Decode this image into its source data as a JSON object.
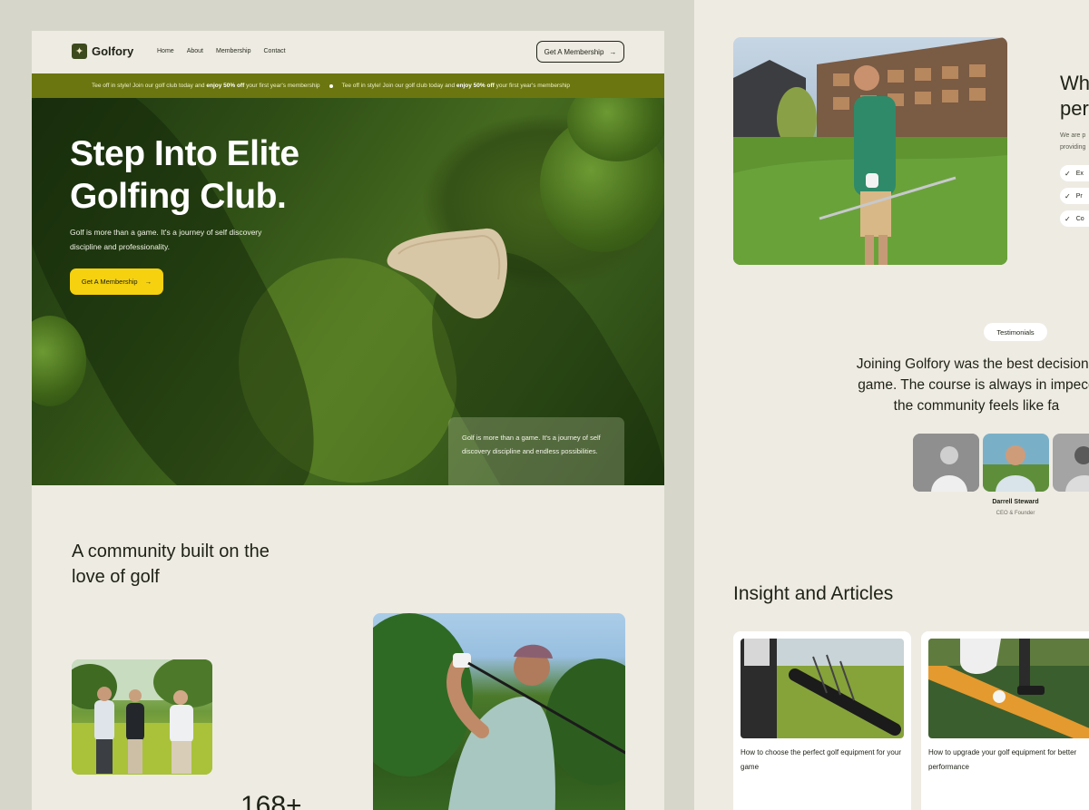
{
  "brand": {
    "name": "Golfory"
  },
  "nav": {
    "links": [
      "Home",
      "About",
      "Membership",
      "Contact"
    ],
    "cta_label": "Get A Membership"
  },
  "ticker": {
    "part1": "Tee off in style! Join our golf club today and",
    "bold": "enjoy 50% off",
    "part2": "your first year's membership"
  },
  "hero": {
    "title": "Step Into Elite Golfing Club.",
    "subtitle": "Golf is more than a game. It's a journey of self discovery discipline and professionality.",
    "cta_label": "Get A Membership",
    "card_text": "Golf is more than a game. It's a journey of self discovery discipline and endless possibilities."
  },
  "community": {
    "title": "A community built on the love of golf",
    "stat": "168+"
  },
  "why": {
    "title_line1": "Wh",
    "title_line2": "per",
    "desc_line1": "We are p",
    "desc_line2": "providing",
    "checks": [
      "Ex",
      "Pr",
      "Co"
    ]
  },
  "testimonials": {
    "badge": "Testimonials",
    "quote_line1": "Joining Golfory was the best decision I",
    "quote_line2": "game. The course is always in impecc",
    "quote_line3": "the community feels like fa",
    "person_name": "Darrell Steward",
    "person_role": "CEO & Founder"
  },
  "insights": {
    "title": "Insight and Articles",
    "articles": [
      {
        "title": "How to choose the perfect golf equipment for your game"
      },
      {
        "title": "How to upgrade your golf equipment for better performance"
      }
    ]
  },
  "colors": {
    "brand_dark": "#3d4a1e",
    "ticker_bg": "#6b7610",
    "cta_yellow": "#f5d10f",
    "page_bg": "#eeebe3",
    "canvas_bg": "#d6d7ca"
  }
}
